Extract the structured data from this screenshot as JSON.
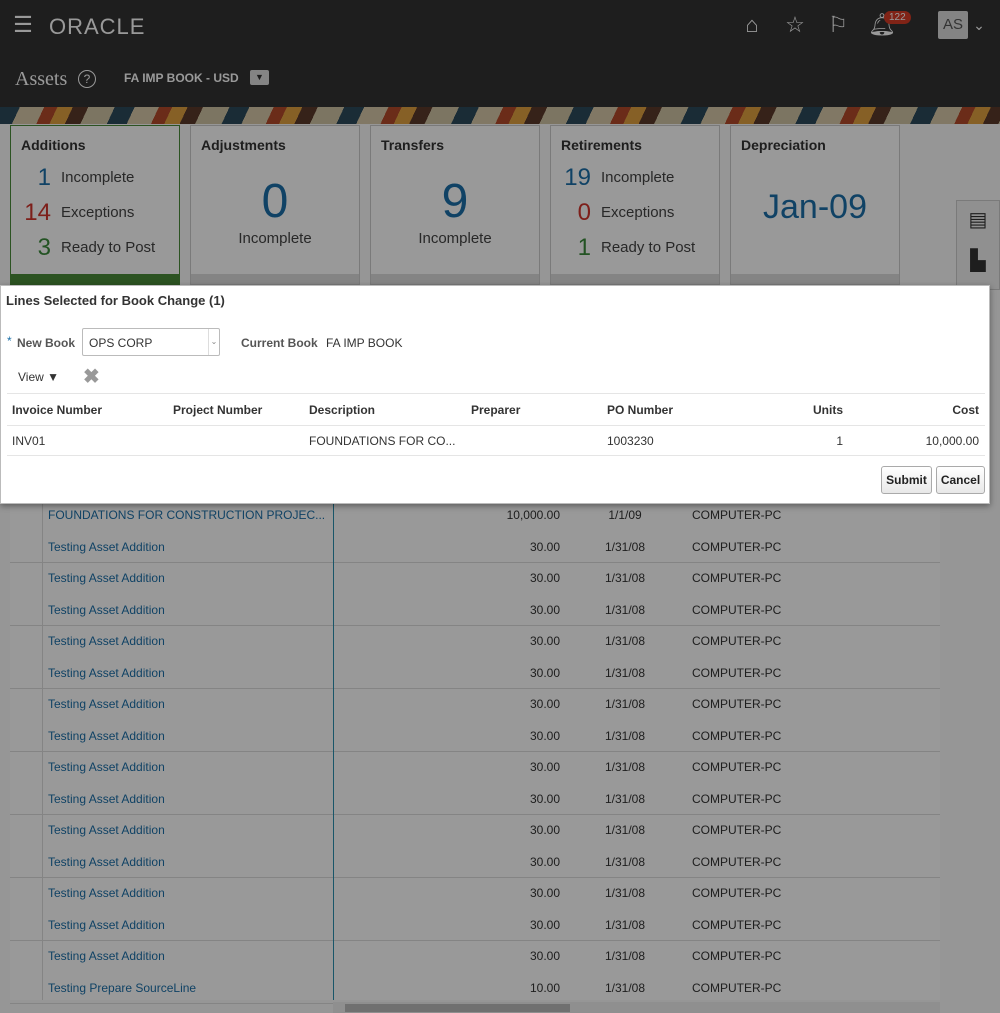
{
  "header": {
    "brand": "ORACLE",
    "notification_count": "122",
    "avatar": "AS",
    "icons": [
      "menu-icon",
      "home-icon",
      "star-icon",
      "flag-icon",
      "bell-icon",
      "chevron-down-icon"
    ]
  },
  "page": {
    "title": "Assets",
    "book": "FA IMP BOOK - USD"
  },
  "cards": {
    "additions": {
      "title": "Additions",
      "lines": [
        {
          "n": "1",
          "label": "Incomplete"
        },
        {
          "n": "14",
          "label": "Exceptions"
        },
        {
          "n": "3",
          "label": "Ready to Post"
        }
      ]
    },
    "adjustments": {
      "title": "Adjustments",
      "value": "0",
      "label": "Incomplete"
    },
    "transfers": {
      "title": "Transfers",
      "value": "9",
      "label": "Incomplete"
    },
    "retirements": {
      "title": "Retirements",
      "lines": [
        {
          "n": "19",
          "label": "Incomplete"
        },
        {
          "n": "0",
          "label": "Exceptions"
        },
        {
          "n": "1",
          "label": "Ready to Post"
        }
      ]
    },
    "depreciation": {
      "title": "Depreciation",
      "value": "Jan-09"
    }
  },
  "colors": {
    "blue": "#1b6fa8",
    "red": "#d0342c",
    "green": "#3b8a3b",
    "badge": "#d63b25"
  },
  "background_rows": [
    [
      "FOUNDATIONS FOR CONSTRUCTION PROJEC...",
      "10,000.00",
      "1/1/09",
      "COMPUTER-PC"
    ],
    [
      "Testing Asset Addition",
      "30.00",
      "1/31/08",
      "COMPUTER-PC"
    ],
    [
      "Testing Asset Addition",
      "30.00",
      "1/31/08",
      "COMPUTER-PC"
    ],
    [
      "Testing Asset Addition",
      "30.00",
      "1/31/08",
      "COMPUTER-PC"
    ],
    [
      "Testing Asset Addition",
      "30.00",
      "1/31/08",
      "COMPUTER-PC"
    ],
    [
      "Testing Asset Addition",
      "30.00",
      "1/31/08",
      "COMPUTER-PC"
    ],
    [
      "Testing Asset Addition",
      "30.00",
      "1/31/08",
      "COMPUTER-PC"
    ],
    [
      "Testing Asset Addition",
      "30.00",
      "1/31/08",
      "COMPUTER-PC"
    ],
    [
      "Testing Asset Addition",
      "30.00",
      "1/31/08",
      "COMPUTER-PC"
    ],
    [
      "Testing Asset Addition",
      "30.00",
      "1/31/08",
      "COMPUTER-PC"
    ],
    [
      "Testing Asset Addition",
      "30.00",
      "1/31/08",
      "COMPUTER-PC"
    ],
    [
      "Testing Asset Addition",
      "30.00",
      "1/31/08",
      "COMPUTER-PC"
    ],
    [
      "Testing Asset Addition",
      "30.00",
      "1/31/08",
      "COMPUTER-PC"
    ],
    [
      "Testing Asset Addition",
      "30.00",
      "1/31/08",
      "COMPUTER-PC"
    ],
    [
      "Testing Asset Addition",
      "30.00",
      "1/31/08",
      "COMPUTER-PC"
    ],
    [
      "Testing Prepare SourceLine",
      "10.00",
      "1/31/08",
      "COMPUTER-PC"
    ]
  ],
  "dialog": {
    "title": "Lines Selected for Book Change (1)",
    "required_mark": "*",
    "new_book_label": "New Book",
    "new_book_value": "OPS CORP",
    "current_book_label": "Current Book",
    "current_book_value": "FA IMP BOOK",
    "view_label": "View ▼",
    "columns": [
      "Invoice Number",
      "Project Number",
      "Description",
      "Preparer",
      "PO Number",
      "Units",
      "Cost"
    ],
    "row": [
      "INV01",
      "",
      "FOUNDATIONS FOR CO...",
      "",
      "1003230",
      "1",
      "10,000.00"
    ],
    "submit": "Submit",
    "cancel": "Cancel"
  }
}
